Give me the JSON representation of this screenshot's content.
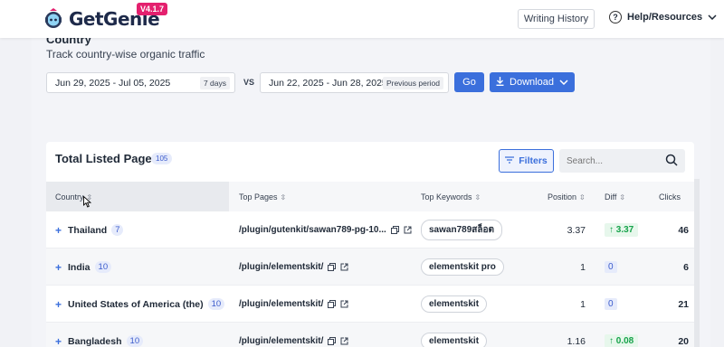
{
  "header": {
    "brand": "GetGenie",
    "version": "V4.1.7",
    "writing_history": "Writing History",
    "help": "Help/Resources"
  },
  "section": {
    "title": "Country",
    "subtitle": "Track country-wise organic traffic"
  },
  "date_range": {
    "current": "Jun 29, 2025 - Jul 05, 2025",
    "current_tag": "7 days",
    "vs": "VS",
    "previous": "Jun 22, 2025 - Jun 28, 2025",
    "previous_tag": "Previous period",
    "go": "Go",
    "download": "Download"
  },
  "table": {
    "title": "Total Listed Pages",
    "count": "105",
    "filters": "Filters",
    "search_placeholder": "Search...",
    "columns": [
      "Country",
      "Top Pages",
      "Top Keywords",
      "Position",
      "Diff",
      "Clicks"
    ],
    "rows": [
      {
        "country": "Thailand",
        "count": "7",
        "page": "/plugin/gutenkit/sawan789-pg-10...",
        "keyword": "sawan789สล็อต",
        "position": "3.37",
        "diff": "3.37",
        "diff_type": "up",
        "clicks": "46"
      },
      {
        "country": "India",
        "count": "10",
        "page": "/plugin/elementskit/",
        "keyword": "elementskit pro",
        "position": "1",
        "diff": "0",
        "diff_type": "zero",
        "clicks": "6"
      },
      {
        "country": "United States of America (the)",
        "count": "10",
        "page": "/plugin/elementskit/",
        "keyword": "elementskit",
        "position": "1",
        "diff": "0",
        "diff_type": "zero",
        "clicks": "21"
      },
      {
        "country": "Bangladesh",
        "count": "10",
        "page": "/plugin/elementskit/",
        "keyword": "elementskit",
        "position": "1.16",
        "diff": "0.08",
        "diff_type": "up",
        "clicks": "20"
      }
    ]
  },
  "colors": {
    "accent": "#3b6fdc",
    "version_badge": "#e4206e",
    "positive": "#16a34a"
  }
}
